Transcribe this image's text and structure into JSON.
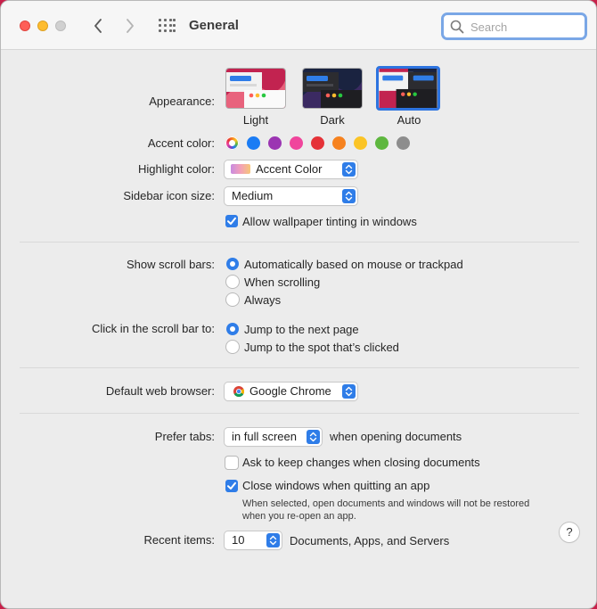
{
  "window": {
    "title": "General",
    "search_placeholder": "Search"
  },
  "appearance": {
    "label": "Appearance:",
    "options": [
      "Light",
      "Dark",
      "Auto"
    ],
    "selected": "Auto"
  },
  "accent": {
    "label": "Accent color:",
    "colors": [
      "multicolor",
      "#1b7cf4",
      "#9b35b2",
      "#f0459c",
      "#e53238",
      "#f6821f",
      "#fbc426",
      "#5eb73f",
      "#8d8d8d"
    ]
  },
  "highlight": {
    "label": "Highlight color:",
    "value": "Accent Color"
  },
  "sidebar_icon": {
    "label": "Sidebar icon size:",
    "value": "Medium"
  },
  "wallpaper_tinting": {
    "label": "Allow wallpaper tinting in windows",
    "checked": true
  },
  "scroll_bars": {
    "label": "Show scroll bars:",
    "options": [
      "Automatically based on mouse or trackpad",
      "When scrolling",
      "Always"
    ],
    "selected": 0
  },
  "click_scroll": {
    "label": "Click in the scroll bar to:",
    "options": [
      "Jump to the next page",
      "Jump to the spot that’s clicked"
    ],
    "selected": 0
  },
  "browser": {
    "label": "Default web browser:",
    "value": "Google Chrome"
  },
  "prefer_tabs": {
    "label": "Prefer tabs:",
    "value": "in full screen",
    "suffix": "when opening documents"
  },
  "ask_keep_changes": {
    "label": "Ask to keep changes when closing documents",
    "checked": false
  },
  "close_windows": {
    "label": "Close windows when quitting an app",
    "checked": true,
    "note_line1": "When selected, open documents and windows will not be restored",
    "note_line2": "when you re-open an app."
  },
  "recent_items": {
    "label": "Recent items:",
    "value": "10",
    "suffix": "Documents, Apps, and Servers"
  },
  "help": {
    "label": "?"
  }
}
